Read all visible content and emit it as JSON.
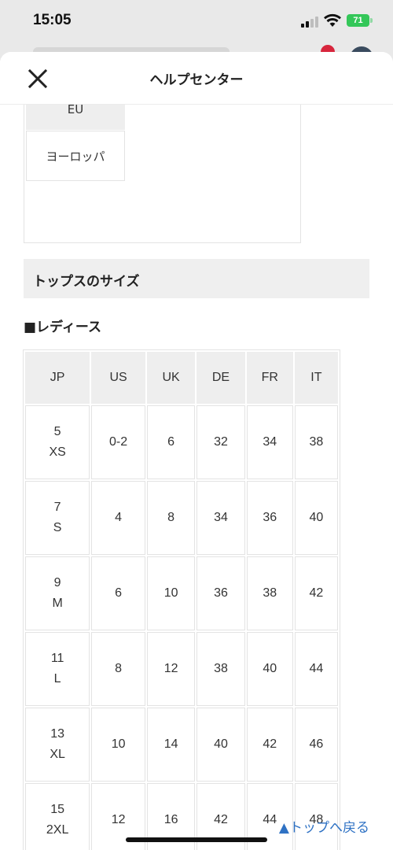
{
  "status_bar": {
    "time": "15:05",
    "battery": "71"
  },
  "header": {
    "title": "ヘルプセンター"
  },
  "region_table": {
    "eu": "EU",
    "europe": "ヨーロッパ"
  },
  "section": {
    "title": "トップスのサイズ"
  },
  "sub_heading": "■レディース",
  "size_table": {
    "headers": [
      "JP",
      "US",
      "UK",
      "DE",
      "FR",
      "IT"
    ],
    "rows": [
      {
        "jp_num": "5",
        "jp_size": "XS",
        "us": "0-2",
        "uk": "6",
        "de": "32",
        "fr": "34",
        "it": "38"
      },
      {
        "jp_num": "7",
        "jp_size": "S",
        "us": "4",
        "uk": "8",
        "de": "34",
        "fr": "36",
        "it": "40"
      },
      {
        "jp_num": "9",
        "jp_size": "M",
        "us": "6",
        "uk": "10",
        "de": "36",
        "fr": "38",
        "it": "42"
      },
      {
        "jp_num": "11",
        "jp_size": "L",
        "us": "8",
        "uk": "12",
        "de": "38",
        "fr": "40",
        "it": "44"
      },
      {
        "jp_num": "13",
        "jp_size": "XL",
        "us": "10",
        "uk": "14",
        "de": "40",
        "fr": "42",
        "it": "46"
      },
      {
        "jp_num": "15",
        "jp_size": "2XL",
        "us": "12",
        "uk": "16",
        "de": "42",
        "fr": "44",
        "it": "48"
      }
    ]
  },
  "back_to_top": "▲トップへ戻る",
  "notification_badge": "1"
}
